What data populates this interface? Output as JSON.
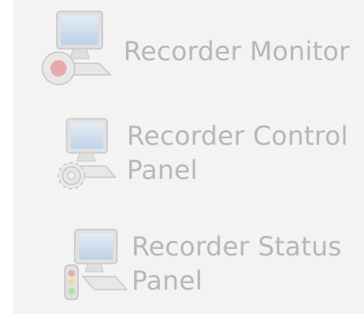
{
  "items": [
    {
      "label": "Recorder Monitor",
      "line2": "",
      "icon": "monitor-record-icon"
    },
    {
      "label": "Recorder Control",
      "line2": "Panel",
      "icon": "monitor-gear-icon"
    },
    {
      "label": "Recorder Status",
      "line2": "Panel",
      "icon": "monitor-traffic-light-icon"
    }
  ],
  "colors": {
    "panel_background": "#f3f3f3",
    "label_text": "#b7b7b7",
    "screen": "#a9c7e8",
    "record_dot": "#e07c7c"
  }
}
